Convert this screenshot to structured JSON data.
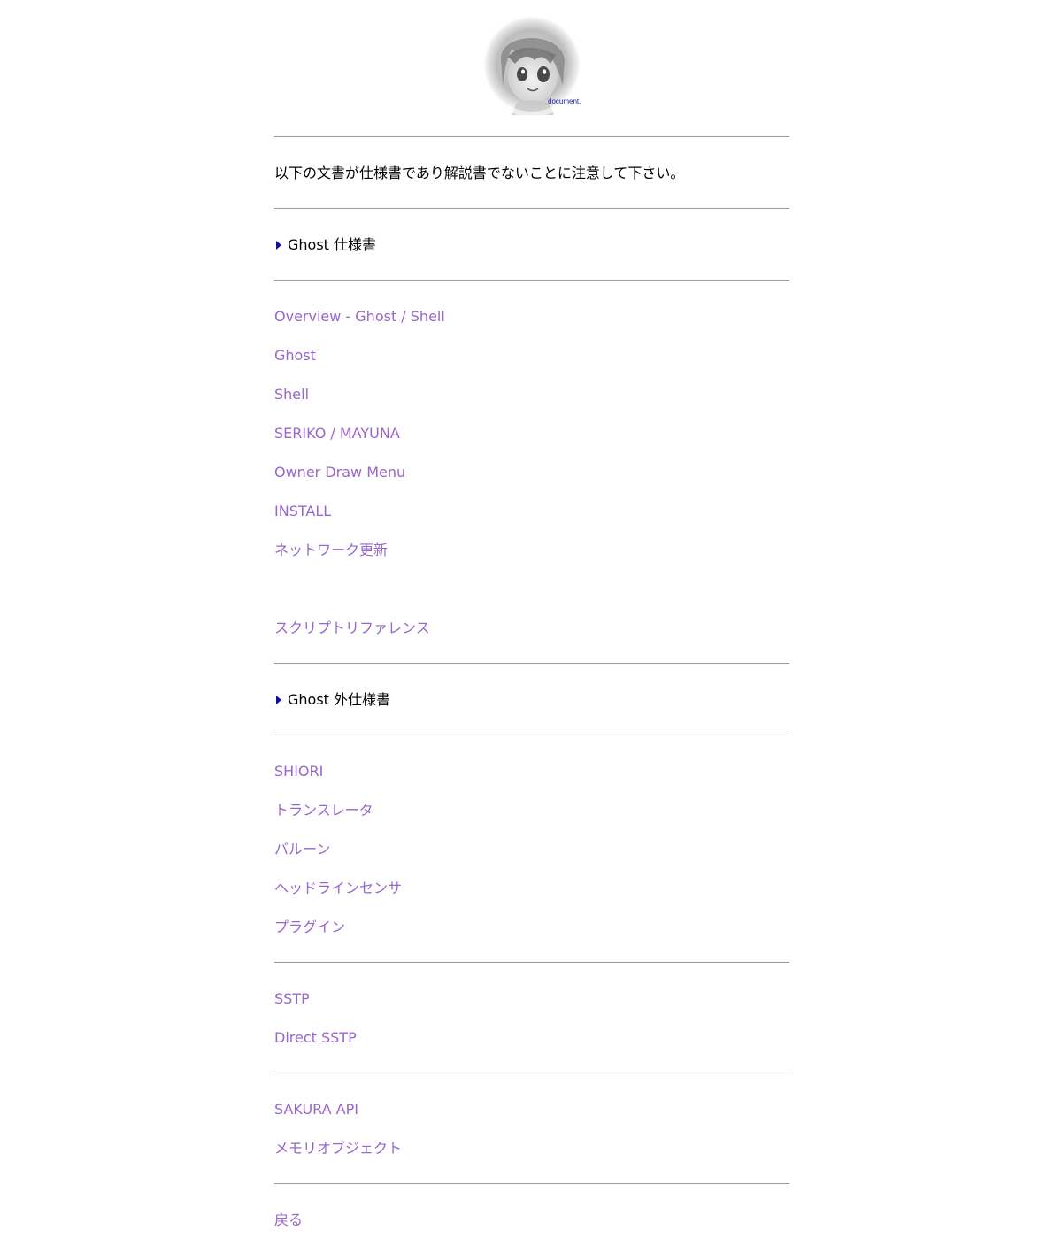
{
  "logo": {
    "caption": "document."
  },
  "notice": "以下の文書が仕様書であり解説書でないことに注意して下さい。",
  "sections": {
    "ghost_spec": {
      "heading": "Ghost 仕様書",
      "links": [
        "Overview - Ghost / Shell",
        "Ghost",
        "Shell",
        "SERIKO / MAYUNA",
        "Owner Draw Menu",
        "INSTALL",
        "ネットワーク更新",
        "スクリプトリファレンス"
      ]
    },
    "external_spec": {
      "heading": "Ghost 外仕様書",
      "links": [
        "SHIORI",
        "トランスレータ",
        "バルーン",
        "ヘッドラインセンサ",
        "プラグイン"
      ]
    },
    "sstp": {
      "links": [
        "SSTP",
        "Direct SSTP"
      ]
    },
    "api": {
      "links": [
        "SAKURA API",
        "メモリオブジェクト"
      ]
    }
  },
  "back_link": "戻る",
  "colors": {
    "link": "#9966cc",
    "rule": "#9a9a9a",
    "bullet": "#1010a0",
    "caption": "#1a1aa6"
  }
}
